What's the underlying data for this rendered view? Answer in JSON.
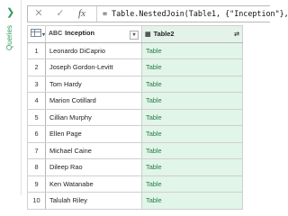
{
  "side_panel": {
    "label": "Queries",
    "collapse_icon": "chevron-right-icon"
  },
  "formula_bar": {
    "cancel_icon": "✕",
    "confirm_icon": "✓",
    "fx_label": "fx",
    "formula": "= Table.NestedJoin(Table1, {\"Inception\"},"
  },
  "grid": {
    "columns": [
      {
        "name": "Inception",
        "type_icon": "ABC"
      },
      {
        "name": "Table2",
        "type_icon": "table"
      }
    ],
    "rows": [
      {
        "index": "1",
        "inception": "Leonardo DiCaprio",
        "table2": "Table"
      },
      {
        "index": "2",
        "inception": "Joseph Gordon-Levitt",
        "table2": "Table"
      },
      {
        "index": "3",
        "inception": "Tom Hardy",
        "table2": "Table"
      },
      {
        "index": "4",
        "inception": "Marion Cotillard",
        "table2": "Table"
      },
      {
        "index": "5",
        "inception": "Cillian Murphy",
        "table2": "Table"
      },
      {
        "index": "6",
        "inception": "Ellen Page",
        "table2": "Table"
      },
      {
        "index": "7",
        "inception": "Michael Caine",
        "table2": "Table"
      },
      {
        "index": "8",
        "inception": "Dileep Rao",
        "table2": "Table"
      },
      {
        "index": "9",
        "inception": "Ken Watanabe",
        "table2": "Table"
      },
      {
        "index": "10",
        "inception": "Talulah Riley",
        "table2": "Table"
      }
    ]
  },
  "colors": {
    "accent": "#2e9a5b",
    "table_cell_bg": "#e1f5e8",
    "table_cell_text": "#2b7a4a"
  }
}
